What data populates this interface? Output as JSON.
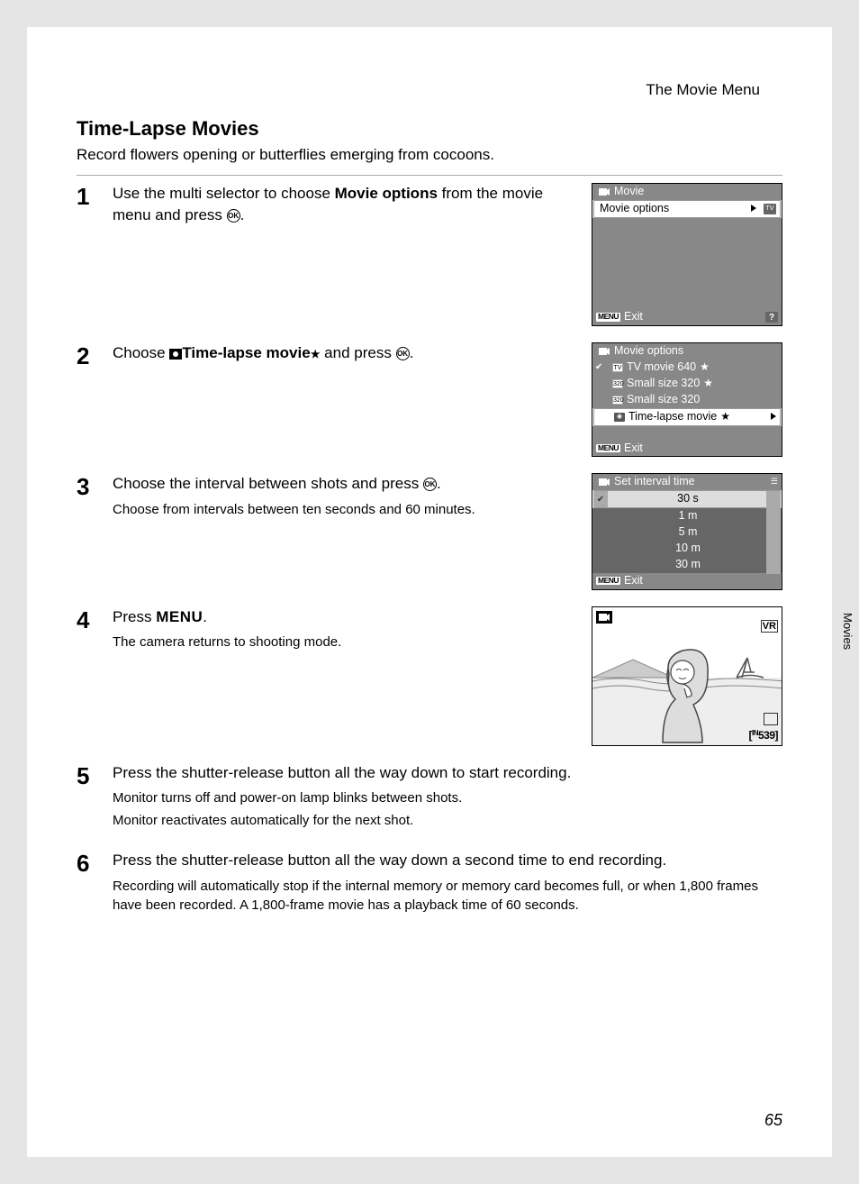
{
  "header": {
    "section": "The Movie Menu"
  },
  "side_label": "Movies",
  "title": "Time-Lapse Movies",
  "intro": "Record flowers opening or butterflies emerging from cocoons.",
  "page_number": "65",
  "ok_label": "OK",
  "menu_label": "MENU",
  "steps": {
    "s1": {
      "num": "1",
      "text_a": "Use the multi selector to choose ",
      "text_b": "Movie options",
      "text_c": " from the movie menu and press ",
      "text_d": "."
    },
    "s2": {
      "num": "2",
      "text_a": "Choose ",
      "text_b": "Time-lapse movie",
      "text_c": " and press ",
      "text_d": "."
    },
    "s3": {
      "num": "3",
      "text_a": "Choose the interval between shots and press ",
      "text_b": ".",
      "note": "Choose from intervals between ten seconds and 60 minutes."
    },
    "s4": {
      "num": "4",
      "text_a": "Press ",
      "text_b": ".",
      "note": "The camera returns to shooting mode."
    },
    "s5": {
      "num": "5",
      "text_a": "Press the shutter-release button all the way down to start recording.",
      "note1": "Monitor turns off and power-on lamp blinks between shots.",
      "note2": "Monitor reactivates automatically for the next shot."
    },
    "s6": {
      "num": "6",
      "text_a": "Press the shutter-release button all the way down a second time to end recording.",
      "note": "Recording will automatically stop if the internal memory or memory card becomes full, or when 1,800 frames have been recorded. A 1,800-frame movie has a playback time of 60 seconds."
    }
  },
  "lcd1": {
    "title": "Movie",
    "row1": "Movie options",
    "exit": "Exit"
  },
  "lcd2": {
    "title": "Movie options",
    "r1": "TV movie 640",
    "r2": "Small size 320",
    "r3": "Small size 320",
    "r4": "Time-lapse movie",
    "exit": "Exit"
  },
  "lcd3": {
    "title": "Set interval time",
    "r1": "30 s",
    "r2": "1 m",
    "r3": "5 m",
    "r4": "10 m",
    "r5": "30 m",
    "exit": "Exit"
  },
  "shooting": {
    "vr": "VR",
    "counter": "[    539]",
    "in": "IN"
  }
}
